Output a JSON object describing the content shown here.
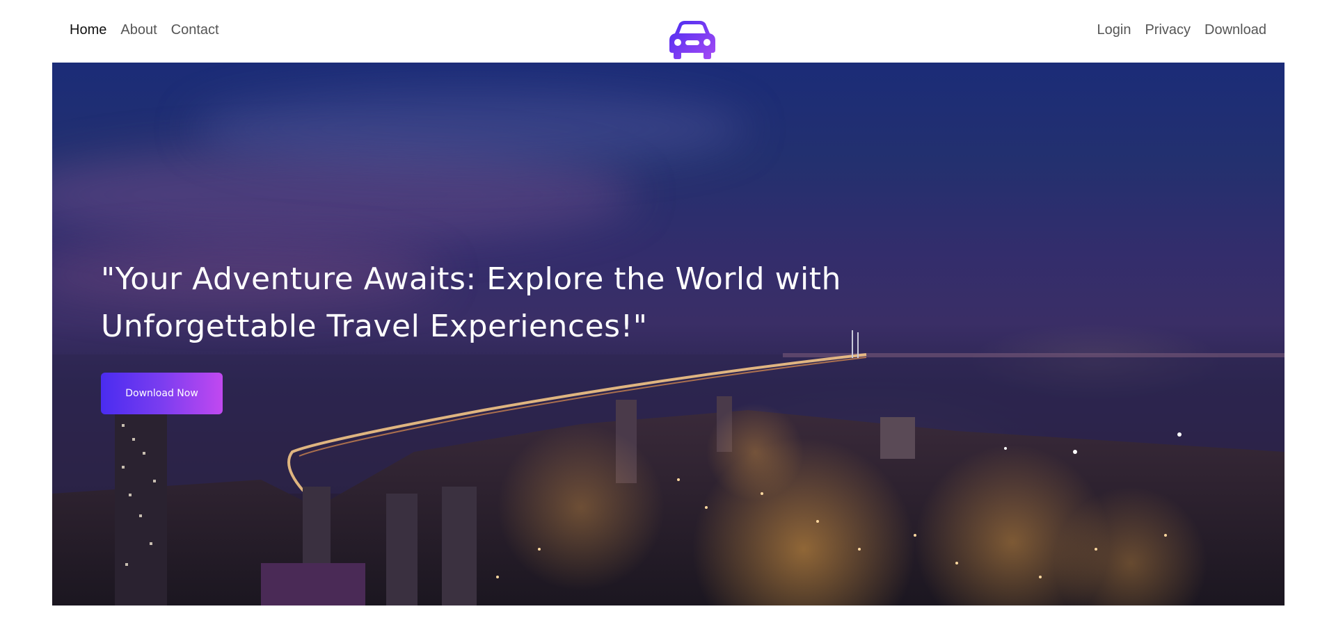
{
  "nav": {
    "left": [
      {
        "label": "Home",
        "active": true
      },
      {
        "label": "About",
        "active": false
      },
      {
        "label": "Contact",
        "active": false
      }
    ],
    "right": [
      {
        "label": "Login"
      },
      {
        "label": "Privacy"
      },
      {
        "label": "Download"
      }
    ]
  },
  "logo": {
    "icon": "car-icon",
    "gradient": [
      "#4a2cf0",
      "#a64bf4"
    ]
  },
  "hero": {
    "title_line1": "\"Your Adventure Awaits: Explore the World with",
    "title_line2": "Unforgettable Travel Experiences!\"",
    "cta_label": "Download Now",
    "background_image": "night-city-bridge-image"
  },
  "colors": {
    "accent_start": "#4a2cf0",
    "accent_end": "#c149f0",
    "nav_text": "#555555",
    "nav_active": "#111111"
  }
}
